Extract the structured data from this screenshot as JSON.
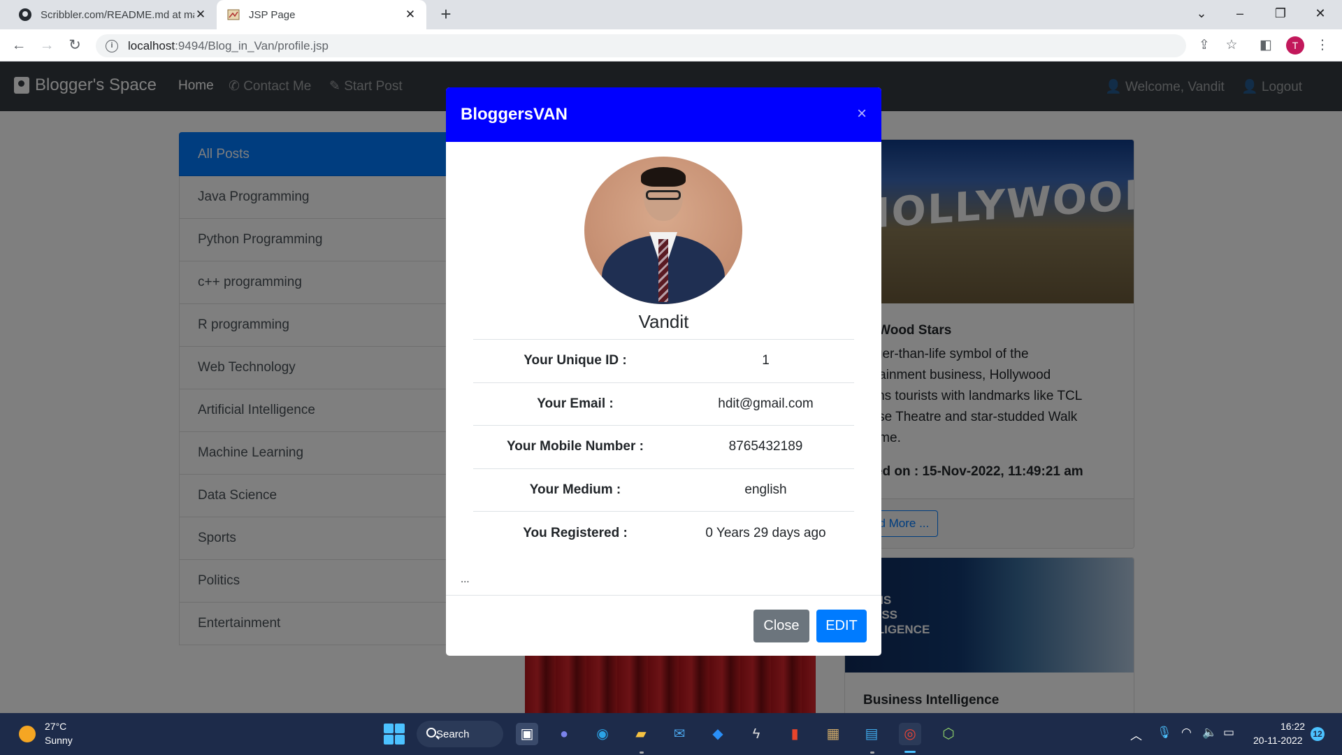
{
  "browser": {
    "tabs": [
      {
        "title": "Scribbler.com/README.md at ma",
        "favicon": "github-icon",
        "active": false
      },
      {
        "title": "JSP Page",
        "favicon": "jsp-page-icon",
        "active": true
      }
    ],
    "url_host": "localhost",
    "url_rest": ":9494/Blog_in_Van/profile.jsp",
    "profile_initial": "T"
  },
  "navbar": {
    "brand": "Blogger's Space",
    "links": [
      {
        "label": "Home",
        "icon": "",
        "active": true
      },
      {
        "label": "Contact Me",
        "icon": "phone-icon",
        "active": false
      },
      {
        "label": "Start Post",
        "icon": "edit-icon",
        "active": false
      }
    ],
    "welcome": "Welcome, Vandit",
    "logout": "Logout"
  },
  "categories": [
    "All Posts",
    "Java Programming",
    "Python Programming",
    "c++ programming",
    "R programming",
    "Web Technology",
    "Artificial Intelligence",
    "Machine Learning",
    "Data Science",
    "Sports",
    "Politics",
    "Entertainment"
  ],
  "post1": {
    "image_text": "HOLLYWOOD",
    "title": "llyWood Stars",
    "text_lines": [
      "arger-than-life symbol of the",
      "ertainment business, Hollywood",
      "kons tourists with landmarks like TCL",
      "nese Theatre and star-studded Walk",
      "Fame."
    ],
    "posted": "sted on : 15-Nov-2022, 11:49:21 am",
    "read_more": "ad More ..."
  },
  "post2": {
    "image_text_lines": [
      "AT IS",
      "INESS",
      "ELLIGENCE"
    ],
    "title": "Business Intelligence"
  },
  "modal": {
    "title": "BloggersVAN",
    "close_symbol": "×",
    "name": "Vandit",
    "rows": [
      {
        "label": "Your Unique ID :",
        "value": "1"
      },
      {
        "label": "Your Email :",
        "value": "hdit@gmail.com"
      },
      {
        "label": "Your Mobile Number :",
        "value": "8765432189"
      },
      {
        "label": "Your Medium :",
        "value": "english"
      },
      {
        "label": "You Registered :",
        "value": "0 Years 29 days ago"
      }
    ],
    "dots": "...",
    "close_button": "Close",
    "edit_button": "EDIT"
  },
  "taskbar": {
    "temperature": "27°C",
    "weather": "Sunny",
    "search": "Search",
    "time": "16:22",
    "date": "20-11-2022",
    "notifications": "12"
  }
}
